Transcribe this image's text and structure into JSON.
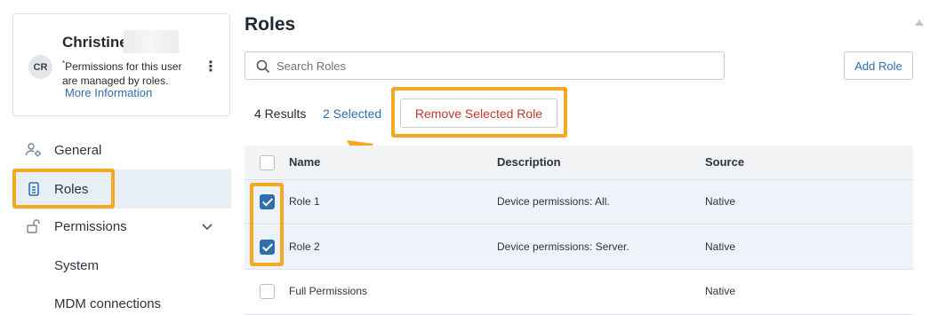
{
  "user": {
    "name": "Christine",
    "initials": "CR",
    "note_star": "*",
    "note": "Permissions for this user are managed by roles.",
    "more_info": "More Information"
  },
  "nav": {
    "general": "General",
    "roles": "Roles",
    "permissions": "Permissions",
    "system": "System",
    "mdm": "MDM connections"
  },
  "page": {
    "title": "Roles",
    "search_placeholder": "Search Roles",
    "add_role": "Add Role",
    "results": "4 Results",
    "selected": "2 Selected",
    "remove_selected": "Remove Selected Role"
  },
  "table": {
    "headers": {
      "name": "Name",
      "description": "Description",
      "source": "Source"
    },
    "rows": [
      {
        "name": "Role 1",
        "description": "Device permissions: All.",
        "source": "Native",
        "checked": true
      },
      {
        "name": "Role 2",
        "description": "Device permissions: Server.",
        "source": "Native",
        "checked": true
      },
      {
        "name": "Full Permissions",
        "description": "",
        "source": "Native",
        "checked": false
      }
    ]
  },
  "colors": {
    "highlight": "#f7a823",
    "accent": "#2f6fb0",
    "danger": "#c0392b"
  }
}
